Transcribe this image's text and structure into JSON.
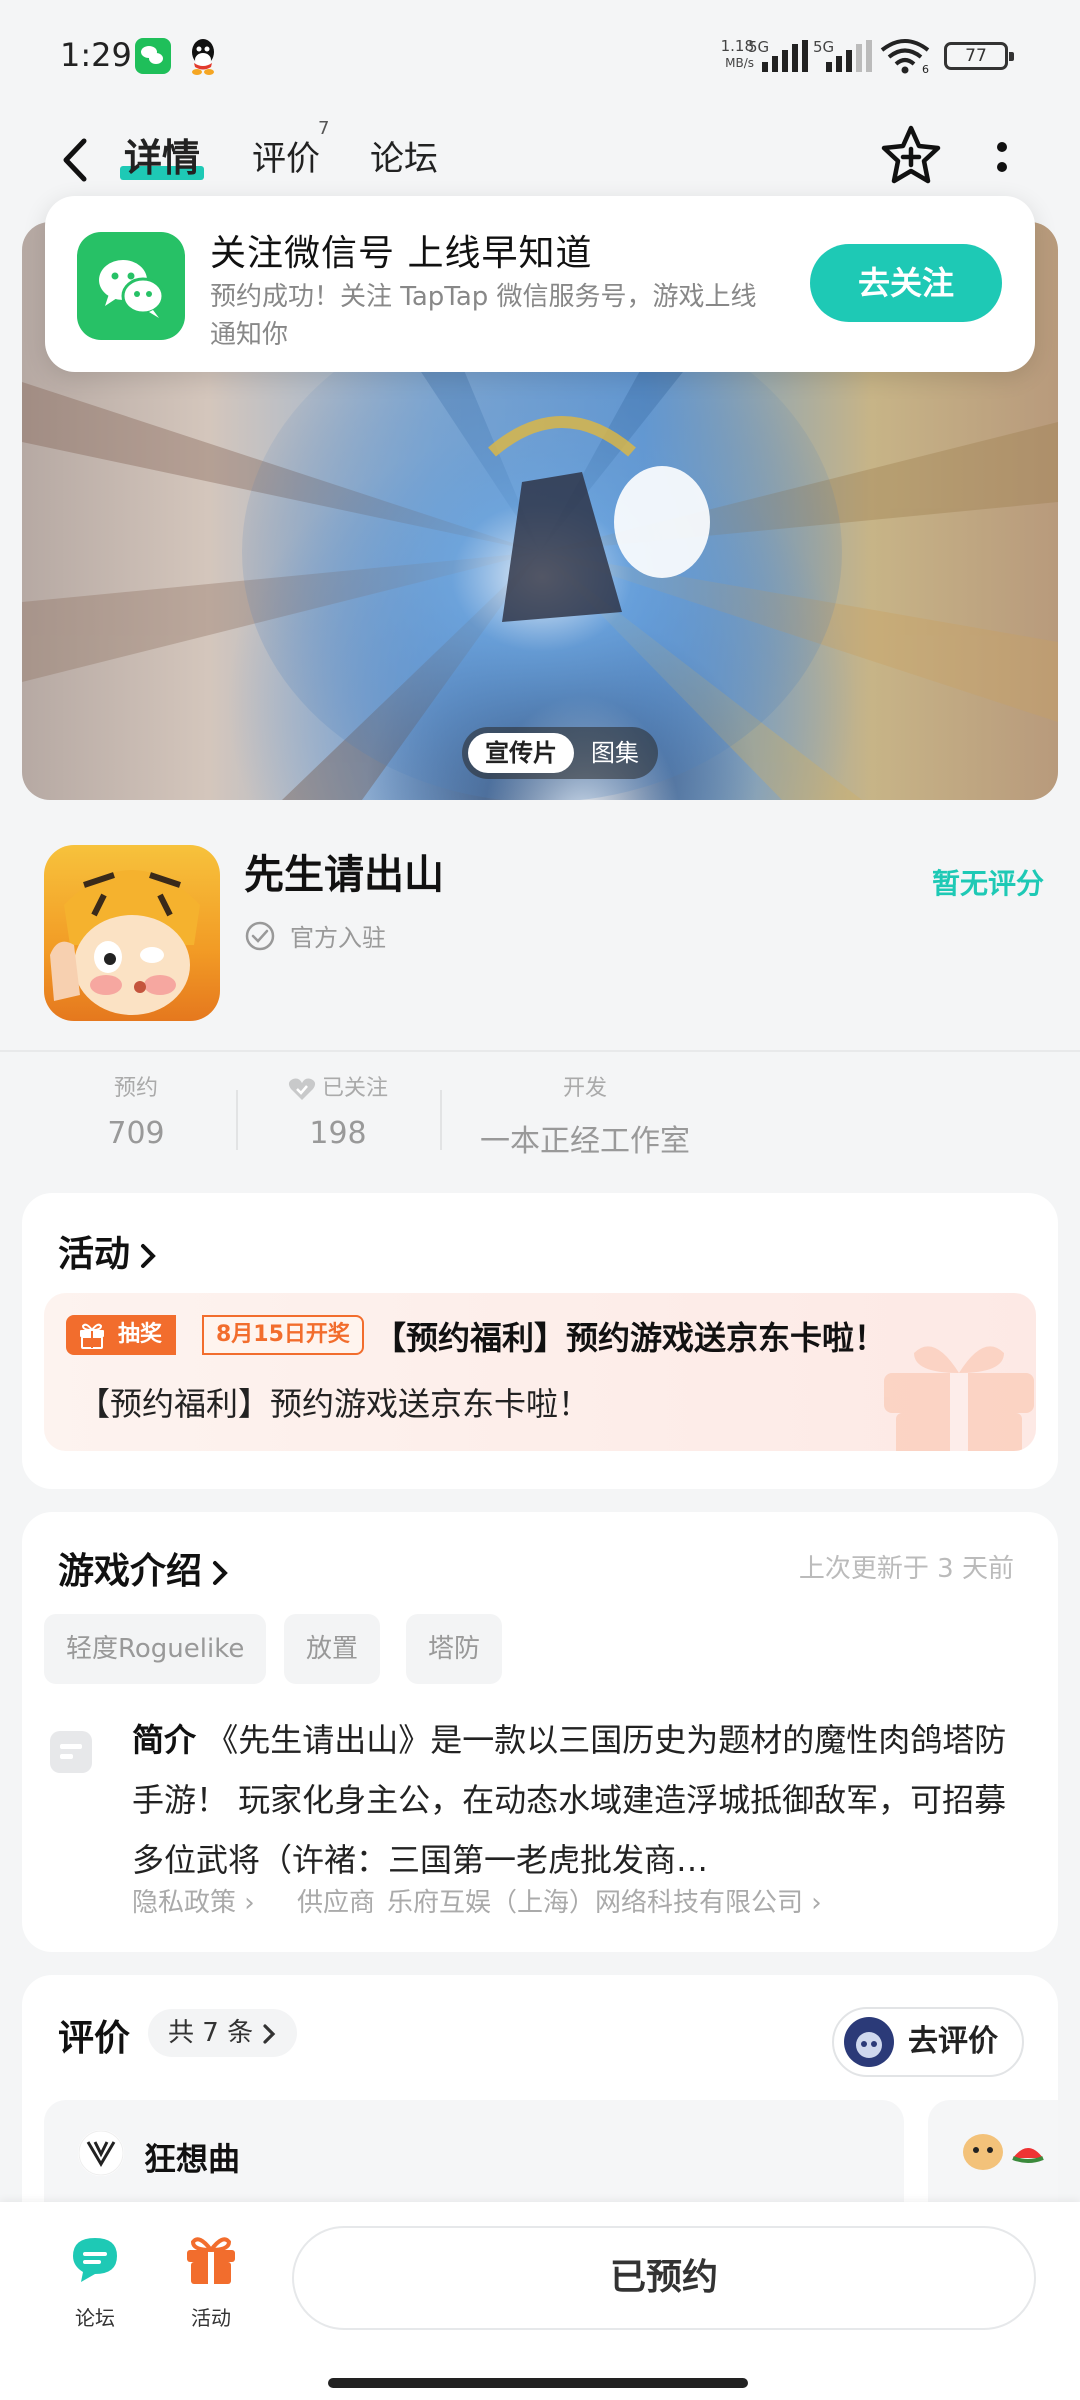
{
  "status_bar": {
    "time": "1:29",
    "net_speed_value": "1.18",
    "net_speed_unit": "MB/s",
    "sim1": "5G",
    "sim2": "5G",
    "wifi_sub": "6",
    "battery": "77"
  },
  "nav": {
    "tabs": [
      {
        "label": "详情",
        "active": true
      },
      {
        "label": "评价",
        "badge": "7"
      },
      {
        "label": "论坛"
      }
    ]
  },
  "follow_popup": {
    "title": "关注微信号 上线早知道",
    "description": "预约成功！关注 TapTap 微信服务号，游戏上线通知你",
    "button": "去关注"
  },
  "banner": {
    "toggle": [
      "宣传片",
      "图集"
    ]
  },
  "game": {
    "name": "先生请出山",
    "official": "官方入驻",
    "rating": "暂无评分"
  },
  "stats": [
    {
      "label": "预约",
      "value": "709"
    },
    {
      "label": "已关注",
      "value": "198"
    },
    {
      "label": "开发",
      "value": "一本正经工作室"
    }
  ],
  "activities": {
    "title": "活动",
    "tag": "抽奖",
    "date_tag": "8月15日开奖",
    "item_title": "【预约福利】预约游戏送京东卡啦！",
    "item_desc": "【预约福利】预约游戏送京东卡啦！"
  },
  "intro": {
    "title": "游戏介绍",
    "updated": "上次更新于 3 天前",
    "tags": [
      "轻度Roguelike",
      "放置",
      "塔防"
    ],
    "summary_label": "简介",
    "summary": "《先生请出山》是一款以三国历史为题材的魔性肉鸽塔防手游！ 玩家化身主公，在动态水域建造浮城抵御敌军，可招募多位武将（许褚：三国第一老虎批发商…",
    "privacy": "隐私政策",
    "supplier_label": "供应商",
    "supplier": "乐府互娱（上海）网络科技有限公司"
  },
  "reviews": {
    "title": "评价",
    "count": "共 7 条",
    "write_button": "去评价",
    "first_reviewer": "狂想曲"
  },
  "bottom_bar": {
    "forum": "论坛",
    "activity": "活动",
    "reserved": "已预约"
  },
  "colors": {
    "accent": "#1ec9b5",
    "orange": "#f26d2d",
    "wechat_green": "#27c166"
  }
}
